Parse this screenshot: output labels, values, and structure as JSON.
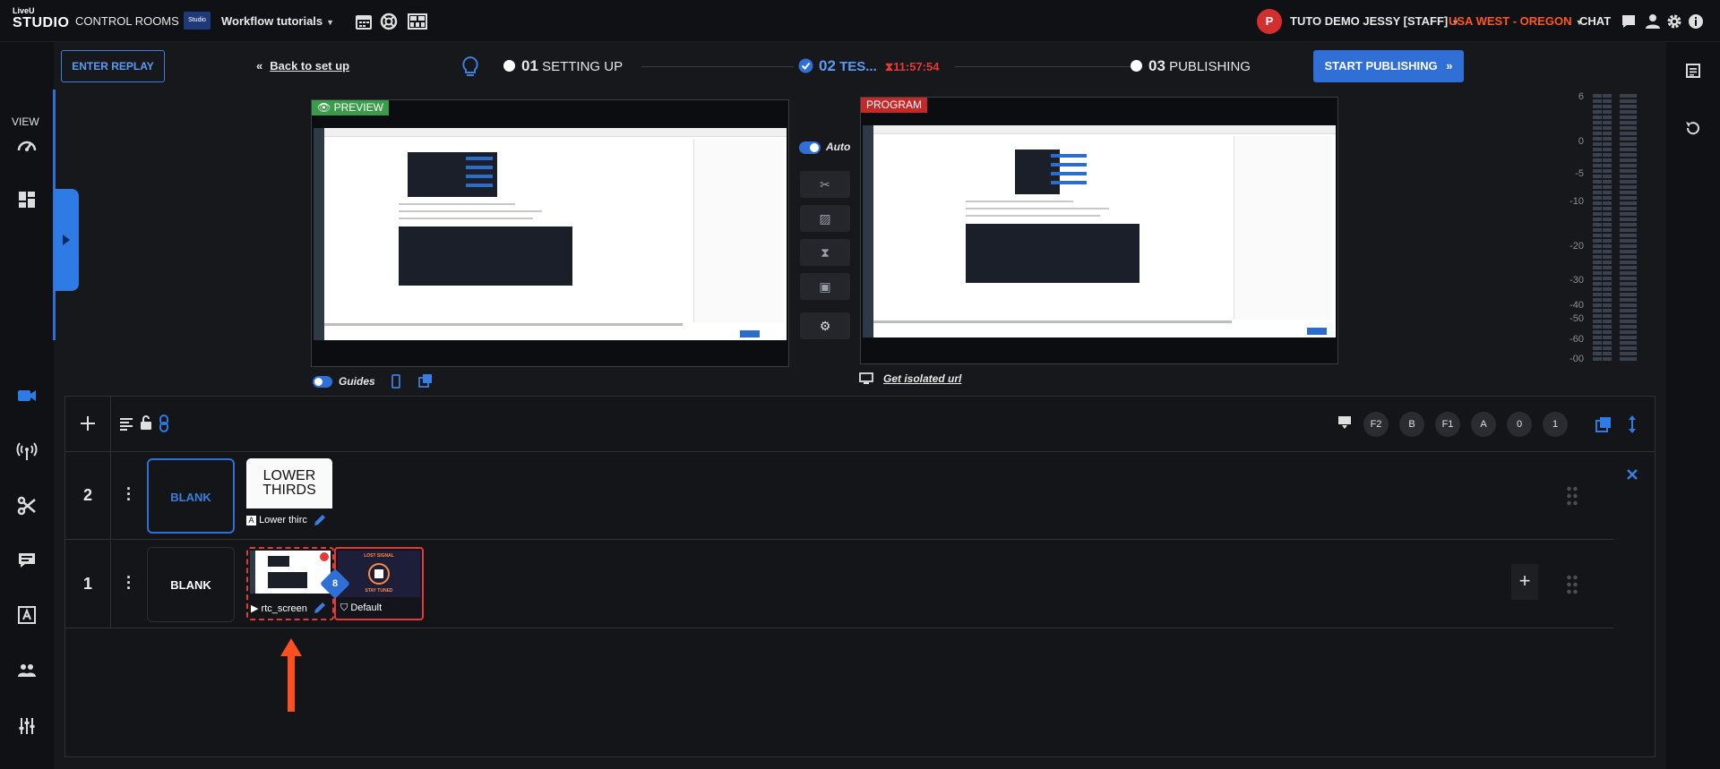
{
  "app": {
    "logo_small": "LiveU",
    "logo_big": "STUDIO",
    "control_rooms": "CONTROL ROOMS",
    "workflow_title": "Workflow tutorials",
    "workflow_badge": "Studio",
    "user_initial": "P",
    "user_name": "TUTO DEMO JESSY [STAFF]",
    "region": "USA WEST - OREGON",
    "chat": "CHAT"
  },
  "sidebar": {
    "view_label": "VIEW"
  },
  "workflow": {
    "enter_replay": "ENTER REPLAY",
    "back_to_setup": "Back to set up",
    "step1_num": "01",
    "step1_label": "SETTING UP",
    "step2_num": "02",
    "step2_label": "TES...",
    "timer": "11:57:54",
    "step3_num": "03",
    "step3_label": "PUBLISHING",
    "start_publishing": "START PUBLISHING"
  },
  "monitors": {
    "preview_label": "PREVIEW",
    "program_label": "PROGRAM",
    "auto_label": "Auto",
    "guides_label": "Guides",
    "isolated_url": "Get isolated url"
  },
  "meter": {
    "scale": [
      "6",
      "0",
      "-5",
      "-10",
      "-20",
      "-30",
      "-40",
      "-50",
      "-60",
      "-00"
    ]
  },
  "layers": {
    "shortcuts": [
      "F2",
      "B",
      "F1",
      "A",
      "0",
      "1"
    ],
    "rows": [
      {
        "number": "2",
        "blank_label": "BLANK",
        "item_title": "LOWER THIRDS",
        "item_label": "Lower thirc"
      },
      {
        "number": "1",
        "blank_label": "BLANK",
        "item_label": "rtc_screen",
        "default_label": "Default",
        "lost_signal_top": "LOST SIGNAL",
        "lost_signal_bottom": "STAY TUNED",
        "badge": "8"
      }
    ]
  },
  "colors": {
    "accent_blue": "#2f6fd6",
    "alert_red": "#e53935",
    "region_orange": "#ff5722",
    "preview_green": "#3a9b4a",
    "program_red": "#c62828"
  }
}
